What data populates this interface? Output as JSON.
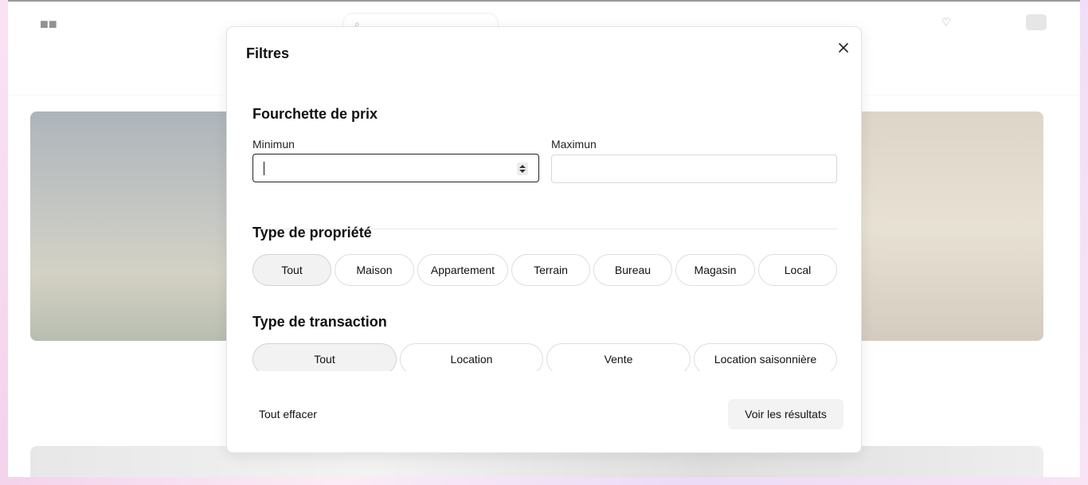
{
  "modal": {
    "title": "Filtres",
    "close_icon": "close-icon"
  },
  "price_range": {
    "title": "Fourchette de prix",
    "min_label": "Minimun",
    "min_value": "",
    "max_label": "Maximun",
    "max_value": ""
  },
  "property_type": {
    "title": "Type de propriété",
    "options": [
      "Tout",
      "Maison",
      "Appartement",
      "Terrain",
      "Bureau",
      "Magasin",
      "Local"
    ],
    "selected": "Tout"
  },
  "transaction_type": {
    "title": "Type de transaction",
    "options": [
      "Tout",
      "Location",
      "Vente",
      "Location saisonnière"
    ],
    "selected": "Tout"
  },
  "footer": {
    "clear_label": "Tout effacer",
    "results_label": "Voir les résultats"
  },
  "colors": {
    "selected_pill": "#f2f2f2",
    "active_border": "#222222"
  }
}
